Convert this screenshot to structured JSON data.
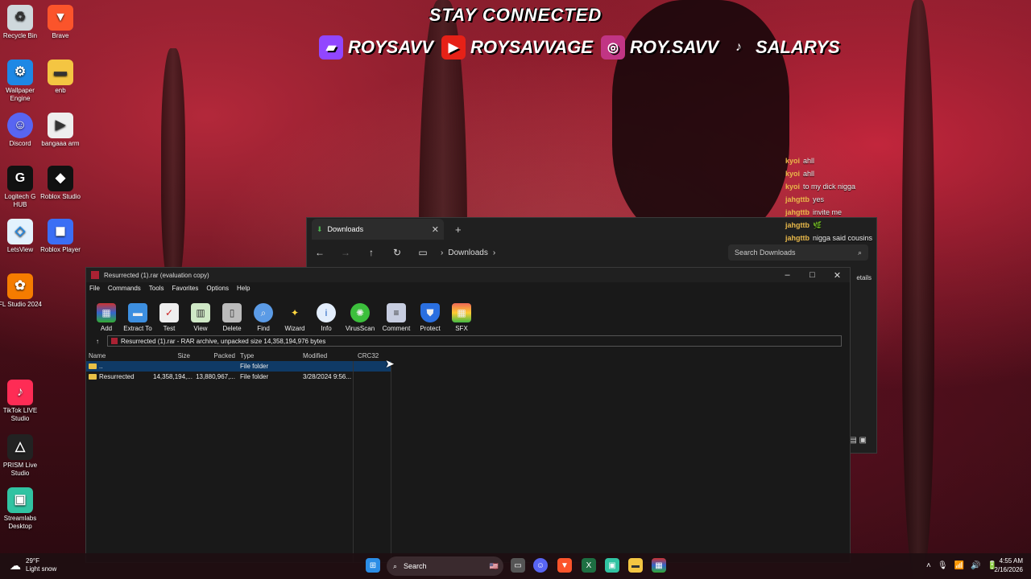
{
  "banner": {
    "title": "STAY CONNECTED",
    "socials": [
      "ROYSAVV",
      "ROYSAVVAGE",
      "ROY.SAVV",
      "SALARYS"
    ]
  },
  "desktop_icons": [
    "Recycle Bin",
    "Brave",
    "Wallpaper Engine",
    "enb",
    "Discord",
    "bangaaa arm",
    "Logitech G HUB",
    "Roblox Studio",
    "LetsView",
    "Roblox Player",
    "FL Studio 2024",
    "TikTok LIVE Studio",
    "PRISM Live Studio",
    "Streamlabs Desktop"
  ],
  "chat": [
    {
      "user": "kyoi",
      "msg": "ahll"
    },
    {
      "user": "kyoi",
      "msg": "ahll"
    },
    {
      "user": "kyoi",
      "msg": "to my dick nigga"
    },
    {
      "user": "jahgttb",
      "msg": "yes"
    },
    {
      "user": "jahgttb",
      "msg": "invite me"
    },
    {
      "user": "jahgttb",
      "msg": "🌿"
    },
    {
      "user": "jahgttb",
      "msg": "nigga said cousins"
    }
  ],
  "explorer": {
    "tab_label": "Downloads",
    "breadcrumb": "Downloads",
    "search_placeholder": "Search Downloads",
    "details_label": "etails"
  },
  "winrar": {
    "title": "Resurrected (1).rar (evaluation copy)",
    "menu": [
      "File",
      "Commands",
      "Tools",
      "Favorites",
      "Options",
      "Help"
    ],
    "toolbar": [
      "Add",
      "Extract To",
      "Test",
      "View",
      "Delete",
      "Find",
      "Wizard",
      "Info",
      "VirusScan",
      "Comment",
      "Protect",
      "SFX"
    ],
    "path": "Resurrected (1).rar - RAR archive, unpacked size 14,358,194,976 bytes",
    "columns": [
      "Name",
      "Size",
      "Packed",
      "Type",
      "Modified",
      "CRC32"
    ],
    "rows": [
      {
        "name": "..",
        "size": "",
        "packed": "",
        "type": "File folder",
        "modified": "",
        "crc": ""
      },
      {
        "name": "Resurrected",
        "size": "14,358,194,...",
        "packed": "13,880,967,...",
        "type": "File folder",
        "modified": "3/28/2024 9:56...",
        "crc": ""
      }
    ]
  },
  "taskbar": {
    "weather_temp": "29°F",
    "weather_desc": "Light snow",
    "search_label": "Search",
    "time": "4:55 AM",
    "date": "2/16/2026"
  }
}
